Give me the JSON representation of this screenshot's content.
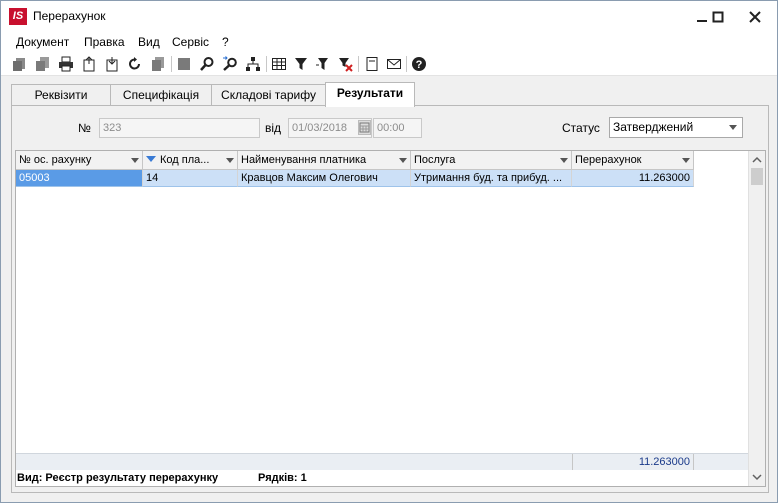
{
  "window": {
    "logo_text": "IS",
    "title": "Перерахунок"
  },
  "menu": [
    "Документ",
    "Правка",
    "Вид",
    "Сервіс",
    "?"
  ],
  "toolbar": {
    "icons": [
      "new-icon",
      "copy-icon",
      "print-icon",
      "export-icon",
      "import-icon",
      "refresh-icon",
      "delete-icon",
      "stop-icon",
      "search-icon",
      "search-next-icon",
      "tree-icon",
      "table-icon",
      "filter-icon",
      "filter-settings-icon",
      "filter-clear-icon",
      "document-icon",
      "mail-icon",
      "help-icon"
    ]
  },
  "tabs": [
    {
      "label": "Реквізити",
      "active": false
    },
    {
      "label": "Специфікація",
      "active": false
    },
    {
      "label": "Складові тарифу",
      "active": false
    },
    {
      "label": "Результати",
      "active": true
    }
  ],
  "form": {
    "number_label": "№",
    "number_value": "323",
    "date_label": "від",
    "date_value": "01/03/2018",
    "time_value": "00:00",
    "status_label": "Статус",
    "status_value": "Затверджений"
  },
  "grid": {
    "columns": [
      "№ ос. рахунку",
      "Код пла...",
      "Найменування платника",
      "Послуга",
      "Перерахунок"
    ],
    "rows": [
      [
        "05003",
        "14",
        "Кравцов Максим Олегович",
        "Утримання буд. та прибуд. ...",
        "11.263000"
      ]
    ],
    "total": "11.263000"
  },
  "status": {
    "view": "Вид: Реєстр результату перерахунку",
    "rows": "Рядків: 1"
  },
  "colors": {
    "accent": "#5a9be6",
    "row_highlight": "#cce0f7",
    "logo": "#c8102e"
  }
}
